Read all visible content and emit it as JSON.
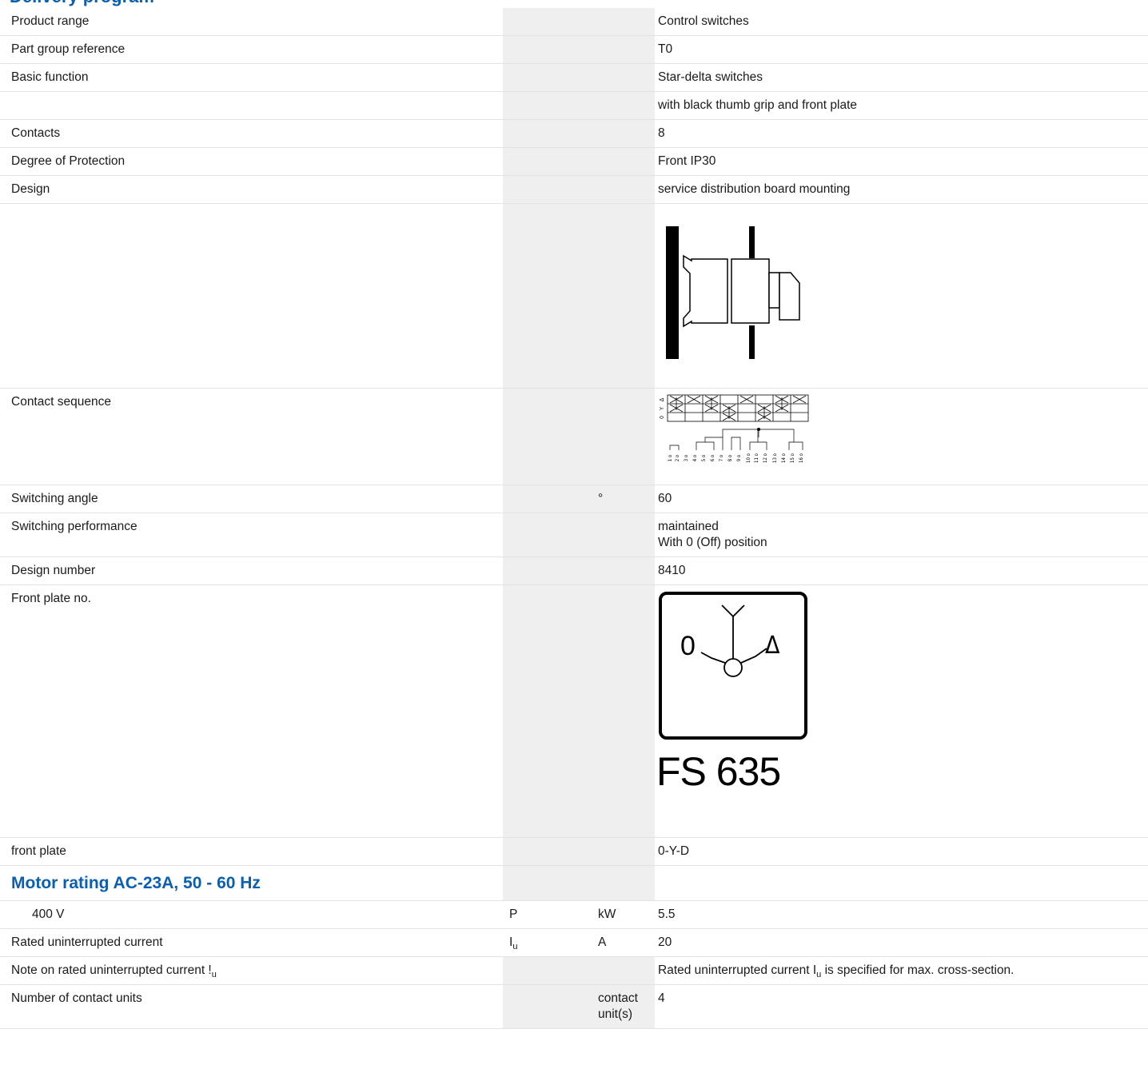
{
  "section_top": {
    "title": "Delivery program"
  },
  "rows": [
    {
      "label": "Product range",
      "symbol": "",
      "unit": "",
      "value": "Control switches"
    },
    {
      "label": "Part group reference",
      "symbol": "",
      "unit": "",
      "value": "T0"
    },
    {
      "label": "Basic function",
      "symbol": "",
      "unit": "",
      "value": "Star-delta switches"
    },
    {
      "label": "",
      "symbol": "",
      "unit": "",
      "value": "with black thumb grip and front plate"
    },
    {
      "label": "Contacts",
      "symbol": "",
      "unit": "",
      "value": "8"
    },
    {
      "label": "Degree of Protection",
      "symbol": "",
      "unit": "",
      "value": "Front IP30"
    },
    {
      "label": "Design",
      "symbol": "",
      "unit": "",
      "value": "service distribution board mounting"
    },
    {
      "label": "Contact sequence",
      "symbol": "",
      "unit": ""
    },
    {
      "label": "Switching angle",
      "symbol": "",
      "unit": "°",
      "value": "60"
    },
    {
      "label": "Switching performance",
      "symbol": "",
      "unit": "",
      "value": "maintained",
      "value2": "With 0 (Off) position"
    },
    {
      "label": "Design number",
      "symbol": "",
      "unit": "",
      "value": "8410"
    },
    {
      "label": "Front plate no.",
      "symbol": "",
      "unit": ""
    },
    {
      "label": "front plate",
      "symbol": "",
      "unit": "",
      "value": "0-Y-D"
    }
  ],
  "front_plate": {
    "label": "FS 635",
    "positions": [
      "0",
      "Y",
      "Δ"
    ]
  },
  "contact_sequence": {
    "positions": [
      "0",
      "Y",
      "Δ"
    ]
  },
  "motor_section": {
    "title": "Motor rating AC-23A, 50 - 60 Hz",
    "rows": [
      {
        "label": "400 V",
        "symbol": "P",
        "unit": "kW",
        "value": "5.5"
      },
      {
        "label": "Rated uninterrupted current",
        "symbol": "I",
        "symbol_sub": "u",
        "unit": "A",
        "value": "20"
      },
      {
        "label": "Note on rated uninterrupted current !",
        "label_sub": "u",
        "symbol": "",
        "unit": "",
        "value_pre": "Rated uninterrupted current I",
        "value_sub": "u",
        "value_post": " is specified for max. cross-section."
      },
      {
        "label": "Number of contact units",
        "symbol": "",
        "unit": "contact unit(s)",
        "value": "4"
      }
    ]
  }
}
